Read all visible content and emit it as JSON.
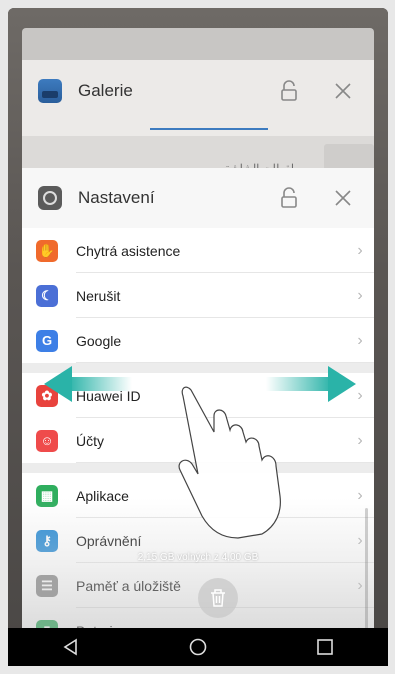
{
  "recents": {
    "galerie": {
      "title": "Galerie",
      "arabic_label": "لقطات الشاشة",
      "icon": "gallery-icon"
    },
    "settings": {
      "title": "Nastavení",
      "icon": "settings-icon",
      "rows": [
        {
          "label": "Chytrá asistence",
          "icon": "hand-icon",
          "color": "#f06a2c"
        },
        {
          "label": "Nerušit",
          "icon": "moon-icon",
          "color": "#4b6fd6"
        },
        {
          "label": "Google",
          "icon": "google-icon",
          "color": "#3d7fe6"
        },
        {
          "label": "Huawei ID",
          "icon": "huawei-icon",
          "color": "#e8433d"
        },
        {
          "label": "Účty",
          "icon": "user-icon",
          "color": "#ef4b4b"
        },
        {
          "label": "Aplikace",
          "icon": "apps-icon",
          "color": "#2fae5e"
        },
        {
          "label": "Oprávnění",
          "icon": "key-icon",
          "color": "#2f8fd6"
        },
        {
          "label": "Paměť a úložiště",
          "icon": "storage-icon",
          "color": "#8a8a8a"
        },
        {
          "label": "Baterie",
          "icon": "battery-icon",
          "color": "#2fae5e"
        }
      ]
    },
    "storage_text": "2,15 GB volných z 4,00 GB"
  },
  "navbar": {
    "back": "back-icon",
    "home": "home-icon",
    "recents": "recents-icon"
  },
  "colors": {
    "arrow": "#2ab3a8",
    "accent": "#3d7bbf"
  }
}
